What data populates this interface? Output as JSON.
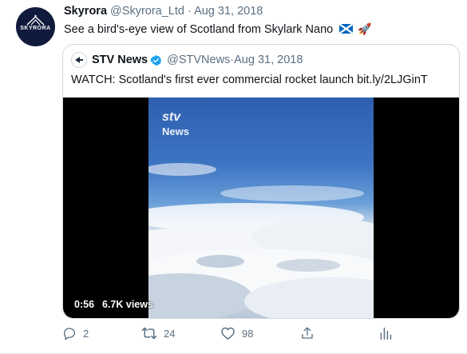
{
  "tweet": {
    "avatar_text": "SKYRORA",
    "name": "Skyrora",
    "handle": "@Skyrora_Ltd",
    "separator": "·",
    "date": "Aug 31, 2018",
    "text": "See a bird's-eye view of Scotland from Skylark Nano",
    "emoji_flag": "scotland-flag-icon",
    "emoji_rocket": "🚀"
  },
  "quote": {
    "name": "STV News",
    "handle": "@STVNews",
    "separator": "·",
    "date": "Aug 31, 2018",
    "text": "WATCH: Scotland's first ever commercial rocket launch bit.ly/2LJGinT",
    "video": {
      "logo_line1": "stv",
      "logo_line2": "News",
      "duration": "0:56",
      "views": "6.7K views"
    }
  },
  "actions": {
    "reply_count": "2",
    "retweet_count": "24",
    "like_count": "98"
  },
  "colors": {
    "secondary_text": "#5b7083",
    "border": "#cfd9de",
    "verified_blue": "#1da1f2",
    "avatar_bg": "#0f1a3c"
  }
}
